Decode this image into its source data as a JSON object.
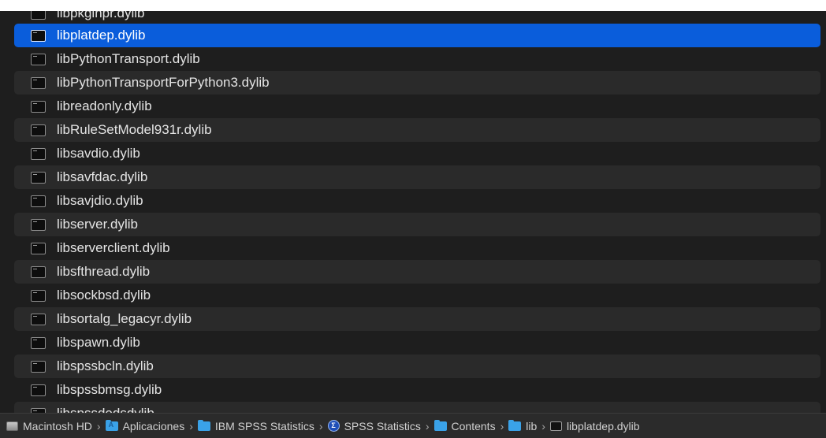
{
  "file_list": {
    "partial_top": "libpkginpr.dylib",
    "items": [
      "libplatdep.dylib",
      "libPythonTransport.dylib",
      "libPythonTransportForPython3.dylib",
      "libreadonly.dylib",
      "libRuleSetModel931r.dylib",
      "libsavdio.dylib",
      "libsavfdac.dylib",
      "libsavjdio.dylib",
      "libserver.dylib",
      "libserverclient.dylib",
      "libsfthread.dylib",
      "libsockbsd.dylib",
      "libsortalg_legacyr.dylib",
      "libspawn.dylib",
      "libspssbcln.dylib",
      "libspssbmsg.dylib"
    ],
    "partial_bottom": "libspssdodsdylib",
    "selected_index": 0
  },
  "path_bar": {
    "separator": "›",
    "crumbs": [
      {
        "label": "Macintosh HD",
        "icon": "hard-drive-icon"
      },
      {
        "label": "Aplicaciones",
        "icon": "applications-folder-icon"
      },
      {
        "label": "IBM SPSS Statistics",
        "icon": "folder-icon"
      },
      {
        "label": "SPSS Statistics",
        "icon": "spss-app-icon",
        "glyph": "Σ"
      },
      {
        "label": "Contents",
        "icon": "folder-icon"
      },
      {
        "label": "lib",
        "icon": "folder-icon"
      },
      {
        "label": "libplatdep.dylib",
        "icon": "document-icon"
      }
    ]
  },
  "colors": {
    "selection": "#0a5ddb",
    "background": "#1e1e1e",
    "alt_row": "#2a2a2a",
    "folder": "#3aa2e8"
  }
}
